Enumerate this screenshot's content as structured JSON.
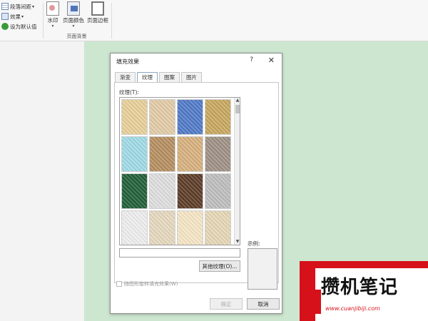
{
  "ribbon": {
    "left_items": [
      {
        "label": "段落间距",
        "icon": "paragraph-spacing-icon",
        "has_dropdown": true
      },
      {
        "label": "效果",
        "icon": "effects-icon",
        "has_dropdown": true
      },
      {
        "label": "设为默认值",
        "icon": "set-default-icon",
        "has_dropdown": false
      }
    ],
    "buttons": [
      {
        "label": "水印",
        "icon": "watermark-icon",
        "arrow": "▾"
      },
      {
        "label": "页面颜色",
        "icon": "page-color-icon",
        "arrow": "▾"
      },
      {
        "label": "页面边框",
        "icon": "page-border-icon",
        "arrow": ""
      }
    ],
    "group_label": "页面背景"
  },
  "dialog": {
    "title": "填充效果",
    "help": "?",
    "close": "✕",
    "tabs": [
      {
        "label": "渐变",
        "active": false
      },
      {
        "label": "纹理",
        "active": true
      },
      {
        "label": "图案",
        "active": false
      },
      {
        "label": "图片",
        "active": false
      }
    ],
    "texture_label": "纹理(T):",
    "textures": [
      "#e8cf98",
      "#e2cba6",
      "#4f79c7",
      "#c7a75d",
      "#9fdbe6",
      "#b58d5e",
      "#d7b07d",
      "#9d8f84",
      "#1f5e36",
      "#dedede",
      "#5a3a25",
      "#bdbdbd",
      "#eeeeee",
      "#e5d8bd",
      "#f5e6c4",
      "#e6d7b5"
    ],
    "selected_texture_index": -1,
    "scroll_up": "▲",
    "scroll_down": "▼",
    "texture_name_value": "",
    "more_textures_button": "其他纹理(O)...",
    "preview_label": "示例:",
    "rotate_label": "随图形旋转填充效果(W)",
    "ok_button": "确定",
    "cancel_button": "取消"
  },
  "watermark": {
    "text": "攒机笔记",
    "url": "www.cuanjibiji.com",
    "color": "#d6111a"
  }
}
